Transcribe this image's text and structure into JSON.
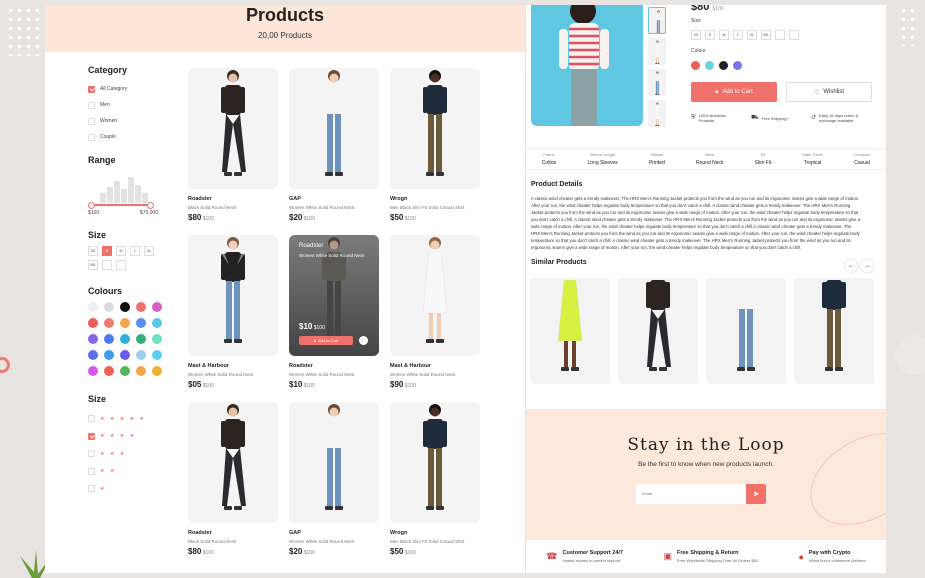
{
  "catalog": {
    "title": "Products",
    "count": "20,00 Products",
    "filters": {
      "category_title": "Category",
      "categories": [
        {
          "label": "All Category",
          "checked": true
        },
        {
          "label": "Men",
          "checked": false
        },
        {
          "label": "Women",
          "checked": false
        },
        {
          "label": "Couple",
          "checked": false
        }
      ],
      "range_title": "Range",
      "range_min": "$100",
      "range_max": "$70,000",
      "size_title": "Size",
      "sizes": [
        "XS",
        "S",
        "M",
        "L",
        "XL",
        "XXL",
        "",
        ""
      ],
      "selected_size": "S",
      "colours_title": "Colours",
      "colours": [
        "#eeeeee",
        "#dcdcdc",
        "#111111",
        "#f0706a",
        "#d55fc1",
        "#f05a5a",
        "#f07c72",
        "#f4a64a",
        "#5b8ef0",
        "#5ac8e8",
        "#8866e8",
        "#4d7cf0",
        "#2fb0d8",
        "#33b07a",
        "#6fe0c0",
        "#5c6fe8",
        "#3e9cf0",
        "#6a5cf0",
        "#9dd0ec",
        "#5ad0f0",
        "#d658e8",
        "#f0605a",
        "#55b460",
        "#f4a64a",
        "#f0b030"
      ],
      "rating_title": "Size",
      "ratings": [
        {
          "stars": "★ ★ ★ ★ ★",
          "checked": false
        },
        {
          "stars": "★ ★ ★ ★",
          "checked": true
        },
        {
          "stars": "★ ★ ★",
          "checked": false
        },
        {
          "stars": "★ ★",
          "checked": false
        },
        {
          "stars": "★",
          "checked": false
        }
      ]
    },
    "products": [
      {
        "name": "Roadster",
        "desc": "Black Solid Round Neck",
        "price": "$80",
        "old": "$100"
      },
      {
        "name": "GAP",
        "desc": "Women White Solid Round Neck",
        "price": "$20",
        "old": "$100"
      },
      {
        "name": "Wrogn",
        "desc": "Men Black Slim Fit Solid Casual Shirt",
        "price": "$50",
        "old": "$100"
      },
      {
        "name": "Mast & Harbour",
        "desc": "Women White Solid Round Neck",
        "price": "$05",
        "old": "$100"
      },
      {
        "name": "Roadster",
        "desc": "Women White Solid Round Neck",
        "price": "$10",
        "old": "$100"
      },
      {
        "name": "Mast & Harbour",
        "desc": "Women White Solid Round Neck",
        "price": "$90",
        "old": "$100"
      },
      {
        "name": "Roadster",
        "desc": "Black Solid Round Neck",
        "price": "$80",
        "old": "$100"
      },
      {
        "name": "GAP",
        "desc": "Women White Solid Round Neck",
        "price": "$20",
        "old": "$100"
      },
      {
        "name": "Wrogn",
        "desc": "Men Black Slim Fit Solid Casual Shirt",
        "price": "$50",
        "old": "$100"
      }
    ],
    "hover": {
      "title": "Roadster",
      "desc": "Women White Solid Round Neck",
      "price": "$10",
      "old": "$100",
      "add": "Add to Cart"
    }
  },
  "detail": {
    "price": "$80",
    "old": "$100",
    "size_label": "Size",
    "sizes": [
      "XS",
      "S",
      "M",
      "L",
      "XL",
      "XXL",
      "",
      ""
    ],
    "colour_label": "Colour",
    "colours": [
      "#f0605a",
      "#6fd0e8",
      "#222222",
      "#7a72e8"
    ],
    "add_to_cart": "Add to Cart",
    "wishlist": "Wishlist",
    "features": [
      {
        "icon": "shield-icon",
        "glyph": "⛨",
        "text": "100% Authentic Products"
      },
      {
        "icon": "truck-icon",
        "glyph": "⛟",
        "text": "Free Shipping*"
      },
      {
        "icon": "return-icon",
        "glyph": "↺",
        "text": "Easy 15 days return & exchange available"
      }
    ],
    "specs": [
      {
        "k": "Fabric",
        "v": "Cotton"
      },
      {
        "k": "Sleeve Length",
        "v": "Long Sleeves"
      },
      {
        "k": "Pattern",
        "v": "Printed"
      },
      {
        "k": "Neck",
        "v": "Round Neck"
      },
      {
        "k": "Fit",
        "v": "Slim Fit"
      },
      {
        "k": "Main Trend",
        "v": "Tropical"
      },
      {
        "k": "Occasion",
        "v": "Casual"
      }
    ],
    "details_title": "Product Details",
    "details_text": "A classic wind cheater gets a trendy makeover. The HRX Men's Running Jacket protects you from the wind as you run and its ergonomic seams give a wide range of motion. After your run, the wind cheater helps regulate body temperature so that you don't catch a chill. A classic wind cheater gets a trendy makeover. The HRX Men's Running Jacket protects you from the wind as you run and its ergonomic seams give a wide range of motion. After your run, the wind cheater helps regulate body temperature so that you don't catch a chill. A classic wind cheater gets a trendy makeover. The HRX Men's Running Jacket protects you from the wind as you run and its ergonomic seams give a wide range of motion. After your run, the wind cheater helps regulate body temperature so that you don't catch a chill.A classic wind cheater gets a trendy makeover. The HRX Men's Running Jacket protects you from the wind as you run and its ergonomic seams give a wide range of motion. After your run, the wind cheater helps regulate body temperature so that you don't catch a chill. A classic wind cheater gets a trendy makeover. The HRX Men's Running Jacket protects you from the wind as you run and its ergonomic seams give a wide range of motion. After your run, the wind cheater helps regulate body temperature so that you don't catch a chill.",
    "similar_title": "Similar Products",
    "newsletter_title": "Stay in the Loop",
    "newsletter_sub": "Be the first to know when new products launch.",
    "email_placeholder": "Email",
    "footer": [
      {
        "icon": "phone-icon",
        "glyph": "☎",
        "title": "Customer Support 24/7",
        "sub": "Instant access to perfect support"
      },
      {
        "icon": "box-icon",
        "glyph": "▣",
        "title": "Free Shipping & Return",
        "sub": "Free Worldwide Shipping Over All Orders $50"
      },
      {
        "icon": "coin-icon",
        "glyph": "●",
        "title": "Pay with Crypto",
        "sub": "World first e-commerce platform"
      }
    ]
  }
}
